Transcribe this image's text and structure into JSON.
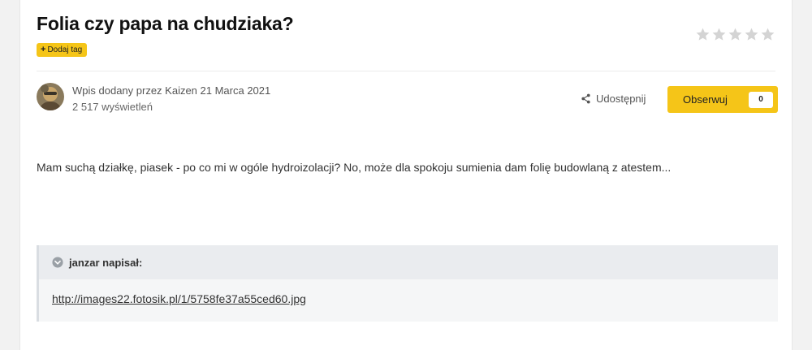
{
  "topic": {
    "title": "Folia czy papa na chudziaka?",
    "add_tag_label": "Dodaj tag"
  },
  "rating": {
    "stars_total": 5,
    "stars_filled": 0,
    "star_color": "#d4d4d4"
  },
  "author": {
    "posted_by_text": "Wpis dodany przez Kaizen 21 Marca 2021",
    "views_text": "2 517 wyświetleń",
    "avatar_icon": "user-avatar"
  },
  "actions": {
    "share_label": "Udostępnij",
    "share_icon": "share-icon",
    "follow_label": "Obserwuj",
    "follow_count": "0"
  },
  "post": {
    "text": "Mam suchą działkę, piasek - po co mi w ogóle hydroizolacji? No, może dla spokoju sumienia dam folię budowlaną z atestem..."
  },
  "quote": {
    "author_text": "janzar napisał:",
    "link_text": "http://images22.fotosik.pl/1/5758fe37a55ced60.jpg"
  },
  "colors": {
    "accent": "#f5c518",
    "quote_bg": "#f5f6f7",
    "quote_header_bg": "#eaecef"
  }
}
